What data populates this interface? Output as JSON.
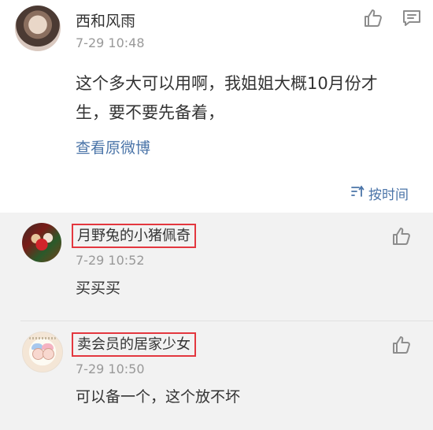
{
  "post": {
    "author": "西和风雨",
    "time": "7-29 10:48",
    "content": "这个多大可以用啊，我姐姐大概10月份才生，要不要先备着，",
    "view_original": "查看原微博",
    "sort_label": "按时间",
    "icons": {
      "like": "thumbs-up-icon",
      "comment": "comment-box-icon",
      "sort": "sort-arrows-icon"
    }
  },
  "comments": [
    {
      "author": "月野兔的小猪佩奇",
      "time": "7-29 10:52",
      "text": "买买买"
    },
    {
      "author": "卖会员的居家少女",
      "time": "7-29 10:50",
      "text": "可以备一个，这个放不坏"
    }
  ],
  "colors": {
    "link": "#4a74a8",
    "highlight_border": "#e3373f",
    "comments_background": "#f2f2f2",
    "muted_text": "#999999"
  }
}
